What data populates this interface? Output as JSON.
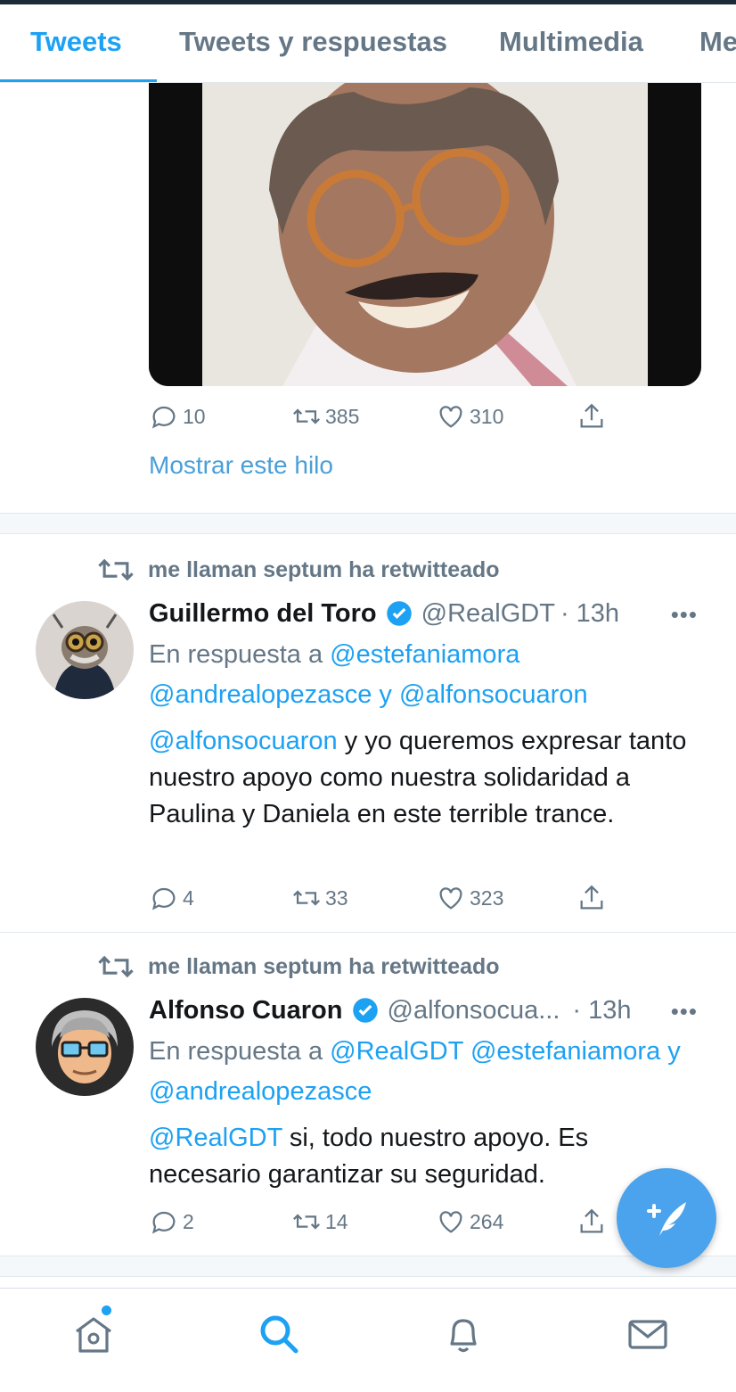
{
  "tabs": [
    {
      "label": "Tweets",
      "active": true
    },
    {
      "label": "Tweets y respuestas",
      "active": false
    },
    {
      "label": "Multimedia",
      "active": false
    },
    {
      "label": "Me",
      "active": false
    }
  ],
  "first_tweet": {
    "media_icon": "photo-man-with-glasses",
    "reply_count": "10",
    "retweet_count": "385",
    "like_count": "310",
    "show_thread": "Mostrar este hilo"
  },
  "tweets": [
    {
      "retweet_by": "me llaman septum ha retwitteado",
      "name": "Guillermo del Toro",
      "handle": "@RealGDT",
      "time": "· 13h",
      "more": "•••",
      "replying_prefix": "En respuesta a",
      "reply_to": [
        "@estefaniamora",
        "@andrealopezasce",
        "y",
        "@alfonsocuaron"
      ],
      "body_mention": "@alfonsocuaron",
      "body_text": " y yo queremos expresar tanto nuestro apoyo como nuestra solidaridad a Paulina y Daniela en este terrible trance.",
      "reply_count": "4",
      "retweet_count": "33",
      "like_count": "323"
    },
    {
      "retweet_by": "me llaman septum ha retwitteado",
      "name": "Alfonso Cuaron",
      "handle": "@alfonsocua...",
      "time": "· 13h",
      "more": "•••",
      "replying_prefix": "En respuesta a",
      "reply_to": [
        "@RealGDT",
        "@estefaniamora",
        "y",
        "@andrealopezasce"
      ],
      "body_mention": "@RealGDT",
      "body_text": " si, todo nuestro apoyo. Es necesario garantizar su seguridad.",
      "reply_count": "2",
      "retweet_count": "14",
      "like_count": "264"
    }
  ],
  "colors": {
    "accent": "#1da1f2",
    "secondary_text": "#657786",
    "fab": "#4aa3ec"
  },
  "bottom_nav": [
    "home-icon",
    "search-icon",
    "bell-icon",
    "mail-icon"
  ]
}
